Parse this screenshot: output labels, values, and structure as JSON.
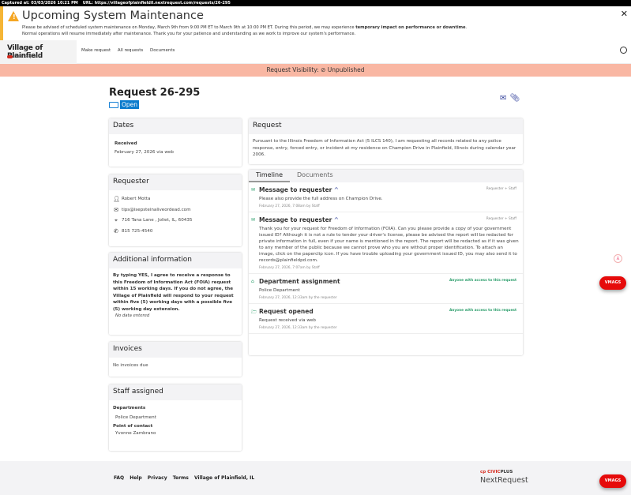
{
  "capture": {
    "captured": "Captured at: 03/03/2026 10:21 PM",
    "url": "URL: https://villageofplainfieldil.nextrequest.com/requests/26-295"
  },
  "banner": {
    "title": "Upcoming System Maintenance",
    "line1": "Please be advised of scheduled system maintenance on Monday, March 9th from 9:00 PM ET to March 9th at 10:00 PM ET. During this period, we may experience ",
    "line1_bold": "temporary impact on performance or downtime",
    "line1_end": ".",
    "line2": "Normal operations will resume immediately after maintenance. Thank you for your patience and understanding as we work to improve our system's performance.",
    "close": "✕"
  },
  "nav": {
    "brand": "Village of Plainfield",
    "product": "NextRequest",
    "links": [
      "Make request",
      "All requests",
      "Documents"
    ]
  },
  "visibility": {
    "label": "Request Visibility:",
    "value": "Unpublished"
  },
  "request": {
    "title": "Request 26-295",
    "status": "Open",
    "body": "Pursuant to the Illinois Freedom of Information Act (5 ILCS 140), I am requesting all records related to any police response, entry, forced entry, or incident at my residence on Champion Drive in Plainfield, Illinois during calendar year 2006.",
    "heading": "Request"
  },
  "dates": {
    "heading": "Dates",
    "label": "Received",
    "value": "February 27, 2026 via web"
  },
  "requester": {
    "heading": "Requester",
    "name": "Robert Motta",
    "email": "tips@isepsteinaliveordead.com",
    "address": "716 Tana Lane , Joliet, IL, 60435",
    "phone": "815 725-4540"
  },
  "additional": {
    "heading": "Additional information",
    "question": "By typing YES, I agree to receive a response to this Freedom of Information Act (FOIA) request within 15 working days. If you do not agree, the Village of Plainfield will respond to your request within five (5) working days with a possible five (5) working day extension.",
    "answer": "No data entered"
  },
  "invoices": {
    "heading": "Invoices",
    "text": "No invoices due"
  },
  "staff": {
    "heading": "Staff assigned",
    "dept_label": "Departments",
    "dept": "Police Department",
    "poc_label": "Point of contact",
    "poc": "Yvonne Zambrano"
  },
  "tabs": [
    "Timeline",
    "Documents"
  ],
  "timeline": [
    {
      "title": "Message to requester",
      "audience": "Requester + Staff",
      "body": "Please also provide the full address on Champion Drive.",
      "meta": "February 27, 2026, 7:08am by Staff"
    },
    {
      "title": "Message to requester",
      "audience": "Requester + Staff",
      "body": "Thank you for your request for Freedom of Information (FOIA). Can you please provide a copy of your government issued ID? Although it is not a rule to tender your driver's license, please be advised the report will be redacted for private information in full, even if your name is mentioned in the report. The report will be redacted as if it was given to any member of the public because we cannot prove who you are without proper identification. To attach an image, click on the paperclip icon. If you have trouble uploading your government issued ID, you may also send it to records@plainfieldpd.com.",
      "meta": "February 27, 2026, 7:07am by Staff"
    },
    {
      "title": "Department assignment",
      "audience": "Anyone with access to this request",
      "body": "Police Department",
      "meta": "February 27, 2026, 12:33am by the requester"
    },
    {
      "title": "Request opened",
      "audience": "Anyone with access to this request",
      "body": "Request received via web",
      "meta": "February 27, 2026, 12:33am by the requester"
    }
  ],
  "footer": {
    "links": [
      "FAQ",
      "Help",
      "Privacy",
      "Terms",
      "Village of Plainfield, IL"
    ],
    "civic": "CIVIC",
    "plus": "PLUS",
    "product": "NextRequest"
  },
  "widget": {
    "label": "VMAGS"
  },
  "colors": {
    "accent": "#0c7ccd",
    "visibility_bg": "#f9b7a3",
    "green": "#2a9d6a"
  }
}
